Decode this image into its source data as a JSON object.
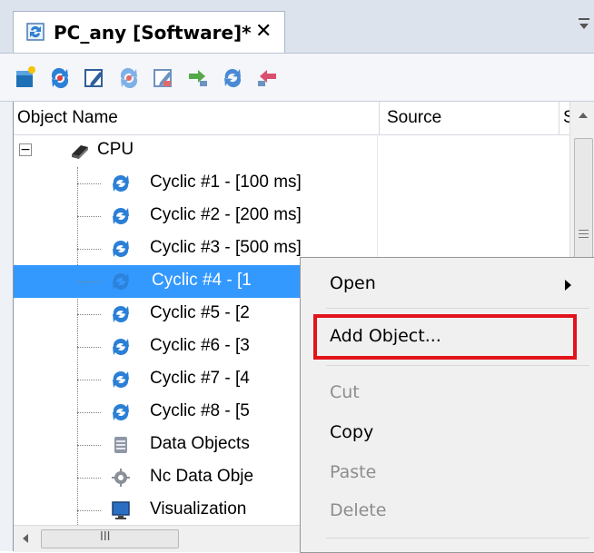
{
  "tab": {
    "title": "PC_any [Software]*",
    "close": "✕"
  },
  "toolbar": {
    "icons": [
      "new-object-icon",
      "open-icon",
      "edit-icon",
      "open-alt-icon",
      "edit-alt-icon",
      "move-icon",
      "refresh-icon",
      "remove-icon"
    ]
  },
  "columns": {
    "name": "Object Name",
    "source": "Source",
    "s": "S"
  },
  "tree": {
    "root": "CPU",
    "expander": "−",
    "items": [
      {
        "label": "Cyclic #1 - [100 ms]",
        "icon": "cyclic-icon"
      },
      {
        "label": "Cyclic #2 - [200 ms]",
        "icon": "cyclic-icon"
      },
      {
        "label": "Cyclic #3 - [500 ms]",
        "icon": "cyclic-icon"
      },
      {
        "label": "Cyclic #4 - [1",
        "icon": "cyclic-icon",
        "selected": true
      },
      {
        "label": "Cyclic #5 - [2",
        "icon": "cyclic-icon"
      },
      {
        "label": "Cyclic #6 - [3",
        "icon": "cyclic-icon"
      },
      {
        "label": "Cyclic #7 - [4",
        "icon": "cyclic-icon"
      },
      {
        "label": "Cyclic #8 - [5",
        "icon": "cyclic-icon"
      },
      {
        "label": "Data Objects",
        "icon": "data-objects-icon"
      },
      {
        "label": "Nc Data Obje",
        "icon": "nc-data-icon"
      },
      {
        "label": "Visualization",
        "icon": "visualization-icon"
      }
    ]
  },
  "context_menu": {
    "items": [
      {
        "label": "Open",
        "submenu": true,
        "disabled": false
      },
      {
        "label": "Add Object...",
        "disabled": false,
        "highlighted": true
      },
      {
        "label": "Cut",
        "disabled": true
      },
      {
        "label": "Copy",
        "disabled": false
      },
      {
        "label": "Paste",
        "disabled": true
      },
      {
        "label": "Delete",
        "disabled": true
      }
    ]
  },
  "scroll": {
    "h_grip": "III"
  },
  "colors": {
    "selection": "#3399ff",
    "highlight_box": "#e2131a"
  }
}
